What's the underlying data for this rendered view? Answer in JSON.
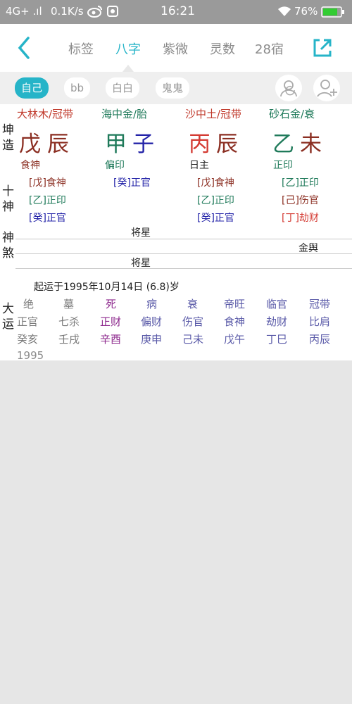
{
  "status": {
    "signal": "4G+ .ıl",
    "speed": "0.1K/s",
    "time": "16:21",
    "battery": "76%"
  },
  "nav": {
    "tabs": [
      "标签",
      "八字",
      "紫微",
      "灵数",
      "28宿"
    ],
    "active": 1
  },
  "persons": {
    "chips": [
      "自己",
      "bb",
      "白白",
      "鬼鬼"
    ],
    "active": 0
  },
  "chart": {
    "label_qiankun": "坤\n造",
    "label_shishen": "十\n神",
    "label_shensha": "神\n煞",
    "label_dayun": "大\n运",
    "pillars": [
      {
        "nayin": "大林木/冠带",
        "nayin_color": "#c0392b",
        "stem": "戊",
        "stem_color": "#8b2e22",
        "branch": "辰",
        "branch_color": "#8b2e22",
        "stem_god": "食神",
        "stem_god_color": "#8b2e22",
        "hidden": [
          {
            "t": "[戊]食神",
            "c": "#8b2e22"
          },
          {
            "t": "[乙]正印",
            "c": "#1f7a5a"
          },
          {
            "t": "[癸]正官",
            "c": "#2323a8"
          }
        ]
      },
      {
        "nayin": "海中金/胎",
        "nayin_color": "#1f7a5a",
        "stem": "甲",
        "stem_color": "#1f7a5a",
        "branch": "子",
        "branch_color": "#2323a8",
        "stem_god": "偏印",
        "stem_god_color": "#1f7a5a",
        "hidden": [
          {
            "t": "[癸]正官",
            "c": "#2323a8"
          }
        ]
      },
      {
        "nayin": "沙中土/冠带",
        "nayin_color": "#c0392b",
        "stem": "丙",
        "stem_color": "#d43a32",
        "branch": "辰",
        "branch_color": "#8b2e22",
        "stem_god": "日主",
        "stem_god_color": "#222222",
        "hidden": [
          {
            "t": "[戊]食神",
            "c": "#8b2e22"
          },
          {
            "t": "[乙]正印",
            "c": "#1f7a5a"
          },
          {
            "t": "[癸]正官",
            "c": "#2323a8"
          }
        ]
      },
      {
        "nayin": "砂石金/衰",
        "nayin_color": "#1f7a5a",
        "stem": "乙",
        "stem_color": "#1f7a5a",
        "branch": "未",
        "branch_color": "#8b2e22",
        "stem_god": "正印",
        "stem_god_color": "#1f7a5a",
        "hidden": [
          {
            "t": "[乙]正印",
            "c": "#1f7a5a"
          },
          {
            "t": "[己]伤官",
            "c": "#8b2e22"
          },
          {
            "t": "[丁]劫财",
            "c": "#d43a32"
          }
        ]
      }
    ],
    "shensha": {
      "row1": "将星",
      "row2": "金舆",
      "row3": "将星"
    },
    "qiyun": "起运于1995年10月14日 (6.8)岁",
    "dayun": {
      "phase": [
        {
          "t": "绝",
          "c": "#7a7a7a"
        },
        {
          "t": "墓",
          "c": "#7a7a7a"
        },
        {
          "t": "死",
          "c": "#8e2a8e"
        },
        {
          "t": "病",
          "c": "#5a5aa8"
        },
        {
          "t": "衰",
          "c": "#5a5aa8"
        },
        {
          "t": "帝旺",
          "c": "#5a5aa8"
        },
        {
          "t": "临官",
          "c": "#5a5aa8"
        },
        {
          "t": "冠带",
          "c": "#5a5aa8"
        }
      ],
      "gods": [
        {
          "t": "正官",
          "c": "#7a7a7a"
        },
        {
          "t": "七杀",
          "c": "#7a7a7a"
        },
        {
          "t": "正财",
          "c": "#8e2a8e"
        },
        {
          "t": "偏财",
          "c": "#5a5aa8"
        },
        {
          "t": "伤官",
          "c": "#5a5aa8"
        },
        {
          "t": "食神",
          "c": "#5a5aa8"
        },
        {
          "t": "劫财",
          "c": "#5a5aa8"
        },
        {
          "t": "比肩",
          "c": "#5a5aa8"
        }
      ],
      "ganzhi": [
        {
          "t": "癸亥",
          "c": "#7a7a7a"
        },
        {
          "t": "壬戌",
          "c": "#7a7a7a"
        },
        {
          "t": "辛酉",
          "c": "#8e2a8e"
        },
        {
          "t": "庚申",
          "c": "#5a5aa8"
        },
        {
          "t": "己未",
          "c": "#5a5aa8"
        },
        {
          "t": "戊午",
          "c": "#5a5aa8"
        },
        {
          "t": "丁巳",
          "c": "#5a5aa8"
        },
        {
          "t": "丙辰",
          "c": "#5a5aa8"
        }
      ],
      "year": "1995"
    }
  }
}
